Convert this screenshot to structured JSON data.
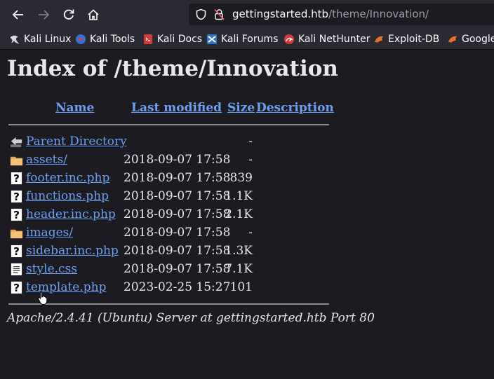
{
  "browser": {
    "url_host": "gettingstarted.htb",
    "url_path": "/theme/Innovation/"
  },
  "bookmarks": [
    {
      "label": "Kali Linux",
      "icon": "kali-dragon-icon"
    },
    {
      "label": "Kali Tools",
      "icon": "kali-tools-icon"
    },
    {
      "label": "Kali Docs",
      "icon": "kali-docs-icon"
    },
    {
      "label": "Kali Forums",
      "icon": "kali-forums-icon"
    },
    {
      "label": "Kali NetHunter",
      "icon": "kali-nethunter-icon"
    },
    {
      "label": "Exploit-DB",
      "icon": "exploit-db-icon"
    },
    {
      "label": "Google",
      "icon": "google-hacking-icon"
    }
  ],
  "page": {
    "title": "Index of /theme/Innovation",
    "columns": {
      "name": "Name",
      "last_modified": "Last modified",
      "size": "Size",
      "description": "Description"
    },
    "entries": [
      {
        "name": "Parent Directory",
        "modified": "",
        "size": "-",
        "icon": "back-arrow-icon"
      },
      {
        "name": "assets/",
        "modified": "2018-09-07 17:58",
        "size": "-",
        "icon": "folder-icon"
      },
      {
        "name": "footer.inc.php",
        "modified": "2018-09-07 17:58",
        "size": "839",
        "icon": "unknown-file-icon"
      },
      {
        "name": "functions.php",
        "modified": "2018-09-07 17:58",
        "size": "1.1K",
        "icon": "unknown-file-icon"
      },
      {
        "name": "header.inc.php",
        "modified": "2018-09-07 17:58",
        "size": "2.1K",
        "icon": "unknown-file-icon"
      },
      {
        "name": "images/",
        "modified": "2018-09-07 17:58",
        "size": "-",
        "icon": "folder-icon"
      },
      {
        "name": "sidebar.inc.php",
        "modified": "2018-09-07 17:58",
        "size": "1.3K",
        "icon": "unknown-file-icon"
      },
      {
        "name": "style.css",
        "modified": "2018-09-07 17:58",
        "size": "7.1K",
        "icon": "text-file-icon"
      },
      {
        "name": "template.php",
        "modified": "2023-02-25 15:27",
        "size": "101",
        "icon": "unknown-file-icon"
      }
    ],
    "footer": "Apache/2.4.41 (Ubuntu) Server at gettingstarted.htb Port 80"
  },
  "colors": {
    "background": "#1c1b22",
    "toolbar": "#2b2a33",
    "link": "#6c9ff0"
  }
}
